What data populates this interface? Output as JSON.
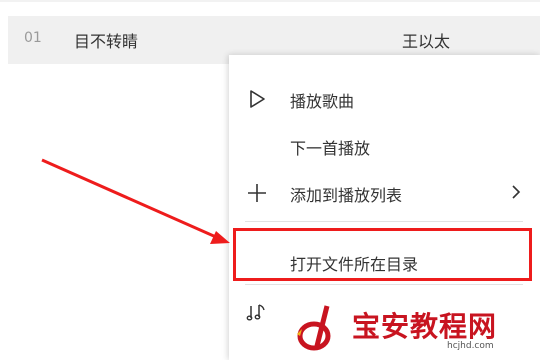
{
  "song_row": {
    "index": "01",
    "title": "目不转睛",
    "artist": "王以太"
  },
  "context_menu": {
    "items": [
      {
        "label": "播放歌曲",
        "icon": "play-icon"
      },
      {
        "label": "下一首播放",
        "icon": ""
      },
      {
        "label": "添加到播放列表",
        "icon": "plus-icon",
        "submenu": "chevron-right-icon"
      },
      {
        "label": "打开文件所在目录",
        "icon": ""
      },
      {
        "label": "",
        "icon": "music-note-icon"
      }
    ]
  },
  "annotation": {
    "color": "#ee1c1c"
  },
  "watermark": {
    "text": "宝安教程网",
    "url": "hcjhd.com",
    "brand_color": "#c81420"
  }
}
